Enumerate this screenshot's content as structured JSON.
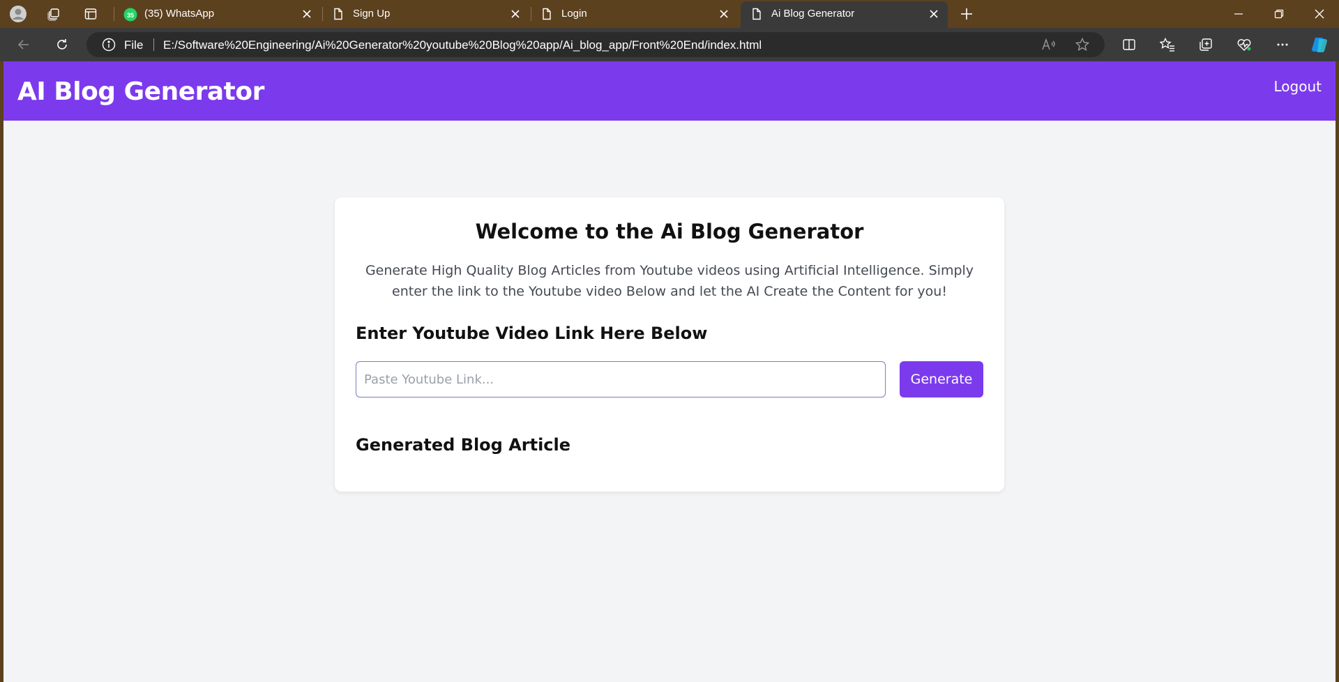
{
  "browser": {
    "tabs": [
      {
        "title": "(35) WhatsApp",
        "badge": "35",
        "active": false
      },
      {
        "title": "Sign Up",
        "active": false
      },
      {
        "title": "Login",
        "active": false
      },
      {
        "title": "Ai Blog Generator",
        "active": true
      }
    ],
    "address": {
      "scheme_label": "File",
      "url": "E:/Software%20Engineering/Ai%20Generator%20youtube%20Blog%20app/Ai_blog_app/Front%20End/index.html"
    },
    "colors": {
      "tabstrip": "#5c411f",
      "toolbar": "#3b3b3b",
      "active_tab": "#3a3a3a"
    }
  },
  "app": {
    "title": "AI Blog Generator",
    "logout_label": "Logout",
    "colors": {
      "brand": "#7c3aed",
      "background": "#f3f4f6"
    }
  },
  "card": {
    "title": "Welcome to the Ai Blog Generator",
    "description": "Generate High Quality Blog Articles from Youtube videos using Artificial Intelligence. Simply enter the link to the Youtube video Below and let the AI Create the Content for you!",
    "input_heading": "Enter Youtube Video Link Here Below",
    "input_value": "",
    "input_placeholder": "Paste Youtube Link...",
    "generate_label": "Generate",
    "article_heading": "Generated Blog Article"
  }
}
